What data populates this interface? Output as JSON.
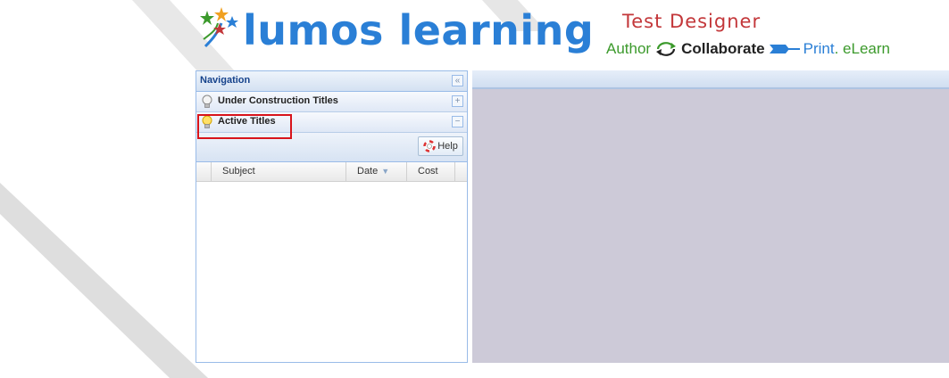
{
  "header": {
    "logo_text": "lumos learning",
    "product_title": "Test Designer",
    "tagline": {
      "author": "Author",
      "collaborate": "Collaborate",
      "print": "Print",
      "elearn": ". eLearn"
    }
  },
  "nav": {
    "title": "Navigation",
    "collapse_symbol": "«",
    "sections": [
      {
        "label": "Under Construction Titles",
        "toggle": "+"
      },
      {
        "label": "Active Titles",
        "toggle": "−"
      }
    ],
    "help_label": "Help",
    "columns": [
      "Subject",
      "Date",
      "Cost"
    ],
    "sort_indicator": "▼"
  },
  "colors": {
    "brand_blue": "#2a7fd6",
    "brand_red": "#c3373a",
    "brand_green": "#3c9a2c",
    "highlight_red": "#d8141b",
    "panel_border": "#99bbe8",
    "content_bg": "#cdcad8"
  },
  "icons": [
    "stars-logo-icon",
    "refresh-cycle-icon",
    "arrow-icon",
    "lightbulb-icon",
    "lifebuoy-icon"
  ]
}
